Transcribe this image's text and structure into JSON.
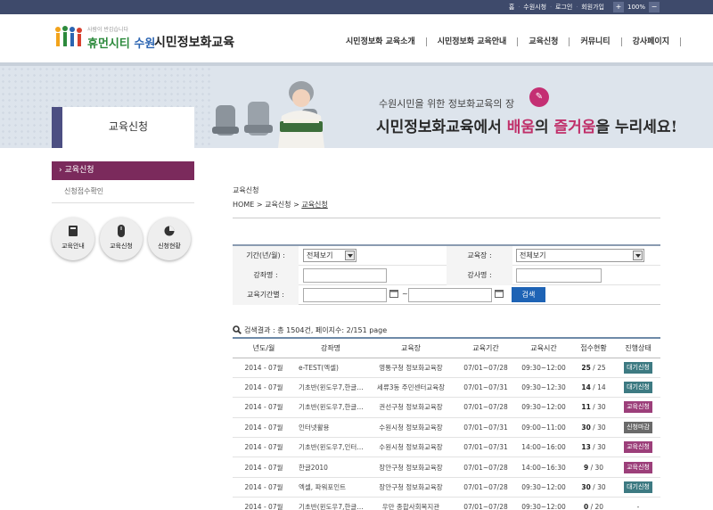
{
  "topbar": {
    "links": [
      "홈",
      "수원시청",
      "로그인",
      "회원가입"
    ],
    "zoom_in": "+",
    "zoom_value": "100%",
    "zoom_out": "−"
  },
  "header": {
    "slogan": "사람이 반갑습니다",
    "brand_prefix": "휴먼시티",
    "brand_city": "수원",
    "title": "시민정보화교육",
    "gnb": [
      "시민정보화 교육소개",
      "시민정보화 교육안내",
      "교육신청",
      "커뮤니티",
      "강사페이지"
    ]
  },
  "banner": {
    "line1": "수원시민을 위한 정보화교육의 장",
    "line2_a": "시민정보화교육에서 ",
    "line2_b": "배움",
    "line2_c": "의 ",
    "line2_d": "즐거움",
    "line2_e": "을 누리세요!"
  },
  "section_title": "교육신청",
  "sidebar": {
    "active": "› 교육신청",
    "sub": "신청접수확인",
    "circles": [
      {
        "label": "교육안내",
        "icon": "book-icon"
      },
      {
        "label": "교육신청",
        "icon": "mouse-icon"
      },
      {
        "label": "신청현황",
        "icon": "pie-chart-icon"
      }
    ]
  },
  "content": {
    "title": "교육신청",
    "breadcrumb": [
      "HOME",
      "교육신청",
      "교육신청"
    ]
  },
  "search": {
    "period_label": "기간(년/월) :",
    "period_value": "전체보기",
    "place_label": "교육장 :",
    "place_value": "전체보기",
    "course_label": "강좌명 :",
    "teacher_label": "강사명 :",
    "dates_label": "교육기간별 :",
    "tilde": "~",
    "button": "검색"
  },
  "result": {
    "text": "검색결과 : 총 1504건, 페이지수: 2/151 page"
  },
  "table": {
    "headers": [
      "년도/월",
      "강좌명",
      "교육장",
      "교육기간",
      "교육시간",
      "접수현황",
      "진행상태"
    ],
    "rows": [
      {
        "ym": "2014 - 07월",
        "name": "e-TEST(엑셀)",
        "place": "영통구청 정보화교육장",
        "period": "07/01~07/28",
        "time": "09:30~12:00",
        "cnt_a": "25",
        "cnt_b": "25",
        "status": "대기신청",
        "status_color": "#3d7a82"
      },
      {
        "ym": "2014 - 07월",
        "name": "기초반(윈도우7,한글…",
        "place": "세류3동 주민센터교육장",
        "period": "07/01~07/31",
        "time": "09:30~12:30",
        "cnt_a": "14",
        "cnt_b": "14",
        "status": "대기신청",
        "status_color": "#3d7a82"
      },
      {
        "ym": "2014 - 07월",
        "name": "기초반(윈도우7,한글…",
        "place": "권선구청 정보화교육장",
        "period": "07/01~07/28",
        "time": "09:30~12:00",
        "cnt_a": "11",
        "cnt_b": "30",
        "status": "교육신청",
        "status_color": "#9c3f7a"
      },
      {
        "ym": "2014 - 07월",
        "name": "인터넷활용",
        "place": "수원시청 정보화교육장",
        "period": "07/01~07/31",
        "time": "09:00~11:00",
        "cnt_a": "30",
        "cnt_b": "30",
        "status": "신청마감",
        "status_color": "#6a6a6a"
      },
      {
        "ym": "2014 - 07월",
        "name": "기초반(윈도우7,인터…",
        "place": "수원시청 정보화교육장",
        "period": "07/01~07/31",
        "time": "14:00~16:00",
        "cnt_a": "13",
        "cnt_b": "30",
        "status": "교육신청",
        "status_color": "#9c3f7a"
      },
      {
        "ym": "2014 - 07월",
        "name": "한글2010",
        "place": "장안구청 정보화교육장",
        "period": "07/01~07/28",
        "time": "14:00~16:30",
        "cnt_a": "9",
        "cnt_b": "30",
        "status": "교육신청",
        "status_color": "#9c3f7a"
      },
      {
        "ym": "2014 - 07월",
        "name": "엑셀, 파워포인트",
        "place": "장안구청 정보화교육장",
        "period": "07/01~07/28",
        "time": "09:30~12:00",
        "cnt_a": "30",
        "cnt_b": "30",
        "status": "대기신청",
        "status_color": "#3d7a82"
      },
      {
        "ym": "2014 - 07월",
        "name": "기초반(윈도우7,한글…",
        "place": "우만 종합사회복지관",
        "period": "07/01~07/28",
        "time": "09:30~12:00",
        "cnt_a": "0",
        "cnt_b": "20",
        "status": "-",
        "status_color": ""
      }
    ]
  }
}
